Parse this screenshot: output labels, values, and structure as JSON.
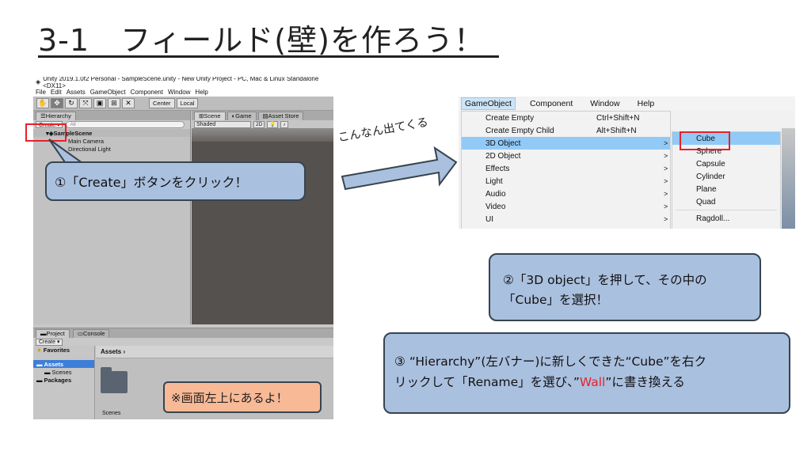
{
  "slide": {
    "title": "3-1　フィールド(壁)を作ろう！",
    "annotation": "こんなん出てくる"
  },
  "unity": {
    "window_title": "Unity 2019.1.0f2 Personal - SampleScene.unity - New Unity Project - PC, Mac & Linux Standalone <DX11>",
    "menu": [
      "File",
      "Edit",
      "Assets",
      "GameObject",
      "Component",
      "Window",
      "Help"
    ],
    "pivot_center": "Center",
    "pivot_local": "Local",
    "hierarchy": {
      "tab": "Hierarchy",
      "create": "Create ▾",
      "search": "All",
      "scene": "SampleScene",
      "children": [
        "Main Camera",
        "Directional Light"
      ]
    },
    "scene_tabs": [
      "Scene",
      "Game",
      "Asset Store"
    ],
    "shading": "Shaded",
    "mode_2d": "2D",
    "project": {
      "tabs": [
        "Project",
        "Console"
      ],
      "create": "Create ▾",
      "favorites": "Favorites",
      "assets": "Assets",
      "scenes": "Scenes",
      "packages": "Packages",
      "breadcrumb": "Assets ›",
      "folder_label": "Scenes"
    }
  },
  "callouts": {
    "step1": "①「Create」ボタンをクリック！",
    "step2_line1": "②「3D object」を押して、その中の",
    "step2_line2": "「Cube」を選択！",
    "step3_line1": "③ “Hierarchy”(左バナー)に新しくできた“Cube”を右ク",
    "step3_line2a": "リックして「Rename」を選び、”",
    "step3_wall": "Wall",
    "step3_line2b": "”に書き換える",
    "note": "※画面左上にあるよ！"
  },
  "gameobject_menu": {
    "menubar": [
      "GameObject",
      "Component",
      "Window",
      "Help"
    ],
    "items": [
      {
        "label": "Create Empty",
        "shortcut": "Ctrl+Shift+N",
        "arrow": ""
      },
      {
        "label": "Create Empty Child",
        "shortcut": "Alt+Shift+N",
        "arrow": ""
      },
      {
        "label": "3D Object",
        "shortcut": "",
        "arrow": ">"
      },
      {
        "label": "2D Object",
        "shortcut": "",
        "arrow": ">"
      },
      {
        "label": "Effects",
        "shortcut": "",
        "arrow": ">"
      },
      {
        "label": "Light",
        "shortcut": "",
        "arrow": ">"
      },
      {
        "label": "Audio",
        "shortcut": "",
        "arrow": ">"
      },
      {
        "label": "Video",
        "shortcut": "",
        "arrow": ">"
      },
      {
        "label": "UI",
        "shortcut": "",
        "arrow": ">"
      }
    ],
    "submenu": [
      "Cube",
      "Sphere",
      "Capsule",
      "Cylinder",
      "Plane",
      "Quad",
      "Ragdoll..."
    ]
  },
  "colors": {
    "callout_blue": "#aac0df",
    "note_orange": "#f8b996",
    "highlight_red": "#e8202a",
    "menu_highlight": "#91c9f7"
  }
}
